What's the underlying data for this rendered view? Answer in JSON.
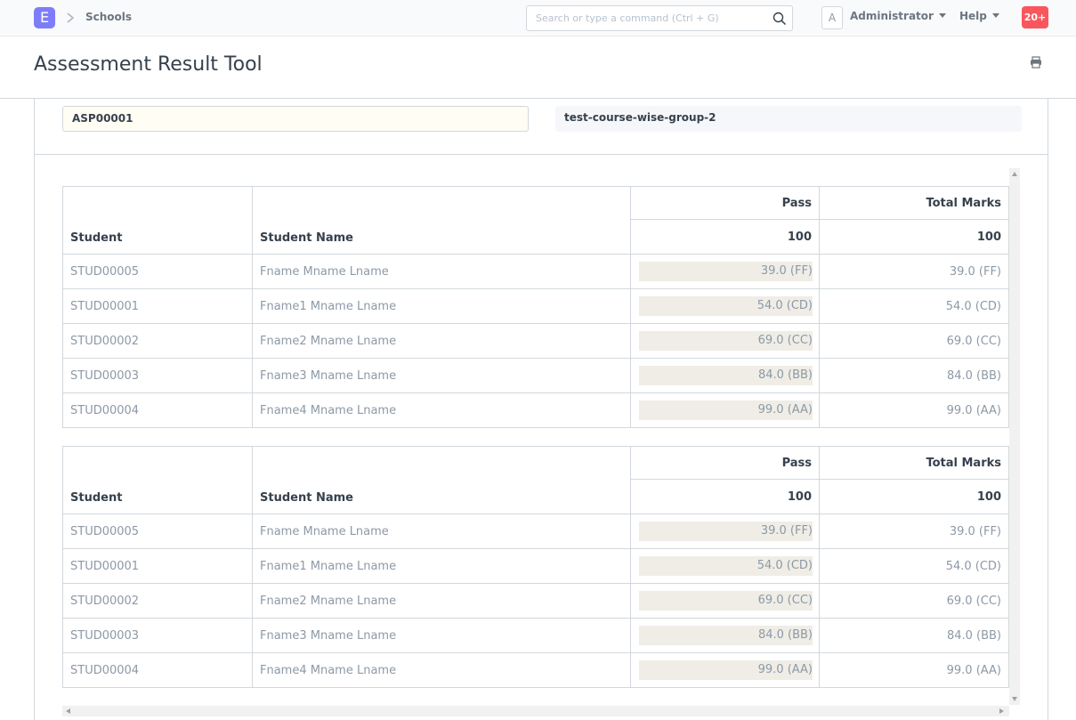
{
  "navbar": {
    "logo_letter": "E",
    "breadcrumb": "Schools",
    "search_placeholder": "Search or type a command (Ctrl + G)",
    "avatar_letter": "A",
    "user": "Administrator",
    "help": "Help",
    "notifications": "20+"
  },
  "page": {
    "title": "Assessment Result Tool"
  },
  "form": {
    "assessment_plan": "ASP00001",
    "student_group": "test-course-wise-group-2"
  },
  "tables": [
    {
      "headers": {
        "student": "Student",
        "student_name": "Student Name",
        "pass": "Pass",
        "total_marks": "Total Marks",
        "pass_max": "100",
        "total_max": "100"
      },
      "rows": [
        {
          "student": "STUD00005",
          "name": "Fname Mname Lname",
          "pass": "39.0 (FF)",
          "total": "39.0 (FF)"
        },
        {
          "student": "STUD00001",
          "name": "Fname1 Mname Lname",
          "pass": "54.0 (CD)",
          "total": "54.0 (CD)"
        },
        {
          "student": "STUD00002",
          "name": "Fname2 Mname Lname",
          "pass": "69.0 (CC)",
          "total": "69.0 (CC)"
        },
        {
          "student": "STUD00003",
          "name": "Fname3 Mname Lname",
          "pass": "84.0 (BB)",
          "total": "84.0 (BB)"
        },
        {
          "student": "STUD00004",
          "name": "Fname4 Mname Lname",
          "pass": "99.0 (AA)",
          "total": "99.0 (AA)"
        }
      ]
    },
    {
      "headers": {
        "student": "Student",
        "student_name": "Student Name",
        "pass": "Pass",
        "total_marks": "Total Marks",
        "pass_max": "100",
        "total_max": "100"
      },
      "rows": [
        {
          "student": "STUD00005",
          "name": "Fname Mname Lname",
          "pass": "39.0 (FF)",
          "total": "39.0 (FF)"
        },
        {
          "student": "STUD00001",
          "name": "Fname1 Mname Lname",
          "pass": "54.0 (CD)",
          "total": "54.0 (CD)"
        },
        {
          "student": "STUD00002",
          "name": "Fname2 Mname Lname",
          "pass": "69.0 (CC)",
          "total": "69.0 (CC)"
        },
        {
          "student": "STUD00003",
          "name": "Fname3 Mname Lname",
          "pass": "84.0 (BB)",
          "total": "84.0 (BB)"
        },
        {
          "student": "STUD00004",
          "name": "Fname4 Mname Lname",
          "pass": "99.0 (AA)",
          "total": "99.0 (AA)"
        }
      ]
    }
  ],
  "colors": {
    "logo": "#7d7dfa",
    "notification": "#f9575d",
    "score_fill": "#efede6",
    "plan_field_bg": "#fffdf4"
  }
}
